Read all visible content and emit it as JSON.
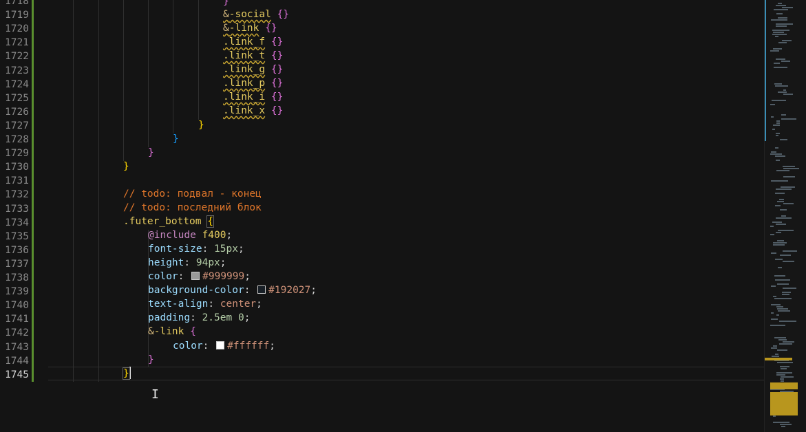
{
  "editor": {
    "line_numbers": [
      "1718",
      "1719",
      "1720",
      "1721",
      "1722",
      "1723",
      "1724",
      "1725",
      "1726",
      "1727",
      "1728",
      "1729",
      "1730",
      "1731",
      "1732",
      "1733",
      "1734",
      "1735",
      "1736",
      "1737",
      "1738",
      "1739",
      "1740",
      "1741",
      "1742",
      "1743",
      "1744",
      "1745"
    ],
    "current_line": "1745",
    "lines": {
      "l1718": "}",
      "l1719_amp": "&",
      "l1719_sel": "-social",
      "l1719_br": "{}",
      "l1720_amp": "&",
      "l1720_sel": "-link",
      "l1720_br": "{}",
      "l1721_sel": ".link_f",
      "l1721_br": "{}",
      "l1722_sel": ".link_t",
      "l1722_br": "{}",
      "l1723_sel": ".link_g",
      "l1723_br": "{}",
      "l1724_sel": ".link_p",
      "l1724_br": "{}",
      "l1725_sel": ".link_i",
      "l1725_br": "{}",
      "l1726_sel": ".link_x",
      "l1726_br": "{}",
      "l1727": "}",
      "l1728": "}",
      "l1729": "}",
      "l1730": "}",
      "l1732": "// todo: подвал - конец",
      "l1733": "// todo: последний блок",
      "l1734_sel": ".futer_bottom",
      "l1734_br": "{",
      "l1735_kw": "@include",
      "l1735_val": "f400",
      "l1736_prop": "font-size",
      "l1736_val": "15px",
      "l1737_prop": "height",
      "l1737_val": "94px",
      "l1738_prop": "color",
      "l1738_val": "#999999",
      "l1739_prop": "background-color",
      "l1739_val": "#192027",
      "l1740_prop": "text-align",
      "l1740_val": "center",
      "l1741_prop": "padding",
      "l1741_val": "2.5em 0",
      "l1742_amp": "&",
      "l1742_sel": "-link",
      "l1742_br": "{",
      "l1743_prop": "color",
      "l1743_val": "#ffffff",
      "l1744": "}",
      "l1745": "}"
    }
  },
  "swatches": {
    "gray": "#999999",
    "dark": "#192027",
    "white": "#ffffff"
  },
  "colors": {
    "background": "#141414",
    "comment": "#e0762a",
    "selector": "#e6cc60",
    "gutter_modified": "#5a8f2e"
  },
  "icons": {
    "mouse_cursor": "text-ibeam-icon"
  }
}
